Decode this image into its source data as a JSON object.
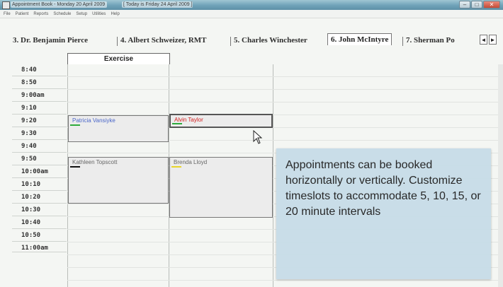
{
  "window": {
    "title_segments": [
      "Appointment Book - Monday 20 April 2009",
      "[ Today is Friday 24 April 2009 ]"
    ]
  },
  "menubar": {
    "items": [
      "File",
      "Patient",
      "Reports",
      "Schedule",
      "Setup",
      "Utilities",
      "Help"
    ]
  },
  "tabs": [
    {
      "label": "3. Dr. Benjamin Pierce",
      "active": false
    },
    {
      "label": "4. Albert Schweizer, RMT",
      "active": false
    },
    {
      "label": "5. Charles Winchester",
      "active": false
    },
    {
      "label": "6. John McIntyre",
      "active": true
    },
    {
      "label": "7. Sherman Po",
      "active": false
    }
  ],
  "tab_scroll": {
    "left": "◄",
    "right": "►"
  },
  "column_header": "Exercise",
  "timeslots": [
    "8:40",
    "8:50",
    "9:00am",
    "9:10",
    "9:20",
    "9:30",
    "9:40",
    "9:50",
    "10:00am",
    "10:10",
    "10:20",
    "10:30",
    "10:40",
    "10:50",
    "11:00am"
  ],
  "appointments": [
    {
      "name": "Patricia Vansiyke",
      "color": "blue",
      "stripe": "#2eaa3c"
    },
    {
      "name": "Alvin Taylor",
      "color": "red",
      "stripe": "#2eaa3c"
    },
    {
      "name": "Kathleen Topscott",
      "color": "gray",
      "stripe": "#111111"
    },
    {
      "name": "Brenda Lloyd",
      "color": "gray",
      "stripe": "#e8d52a"
    }
  ],
  "note": "Appointments can be booked horizontally or vertically. Customize timeslots to accommodate 5, 10, 15, or 20 minute intervals"
}
